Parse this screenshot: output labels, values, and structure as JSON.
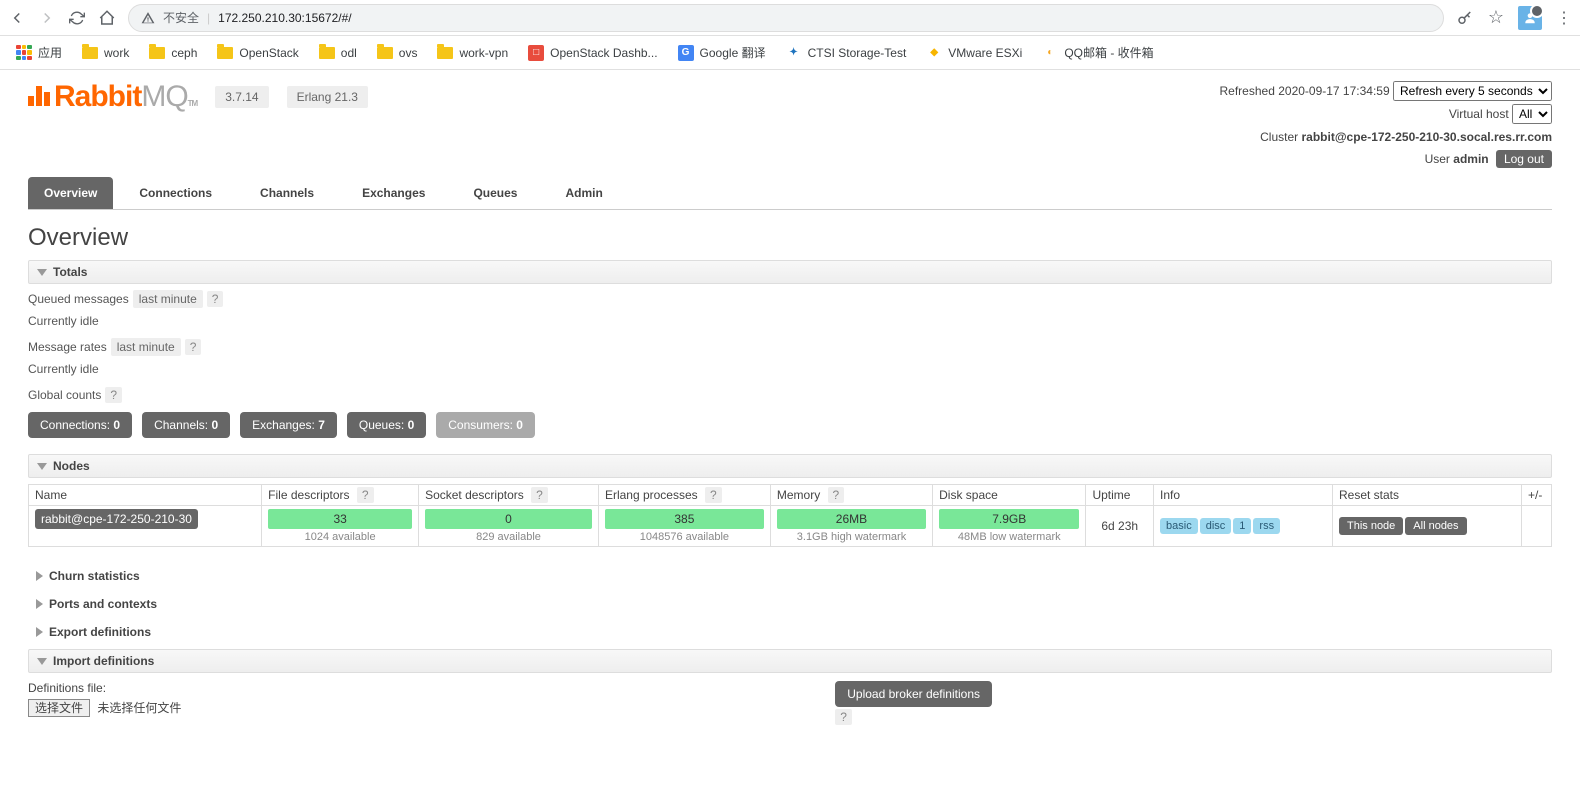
{
  "browser": {
    "insecure": "不安全",
    "url": "172.250.210.30:15672/#/",
    "apps": "应用",
    "bookmarks": [
      {
        "label": "work",
        "type": "folder"
      },
      {
        "label": "ceph",
        "type": "folder"
      },
      {
        "label": "OpenStack",
        "type": "folder"
      },
      {
        "label": "odl",
        "type": "folder"
      },
      {
        "label": "ovs",
        "type": "folder"
      },
      {
        "label": "work-vpn",
        "type": "folder"
      },
      {
        "label": "OpenStack Dashb...",
        "type": "icon",
        "bg": "#e84c3d",
        "fg": "#fff",
        "ch": "□"
      },
      {
        "label": "Google 翻译",
        "type": "icon",
        "bg": "#4285f4",
        "fg": "#fff",
        "ch": "G"
      },
      {
        "label": "CTSI Storage-Test",
        "type": "icon",
        "bg": "#fff",
        "fg": "#1e73be",
        "ch": "✦"
      },
      {
        "label": "VMware ESXi",
        "type": "icon",
        "bg": "#fff",
        "fg": "#f7b500",
        "ch": "◆"
      },
      {
        "label": "QQ邮箱 - 收件箱",
        "type": "icon",
        "bg": "#fff",
        "fg": "#f5a623",
        "ch": "◐"
      }
    ]
  },
  "header": {
    "version": "3.7.14",
    "erlang": "Erlang 21.3",
    "refreshed_lbl": "Refreshed",
    "refreshed_time": "2020-09-17 17:34:59",
    "refresh_options": [
      "Refresh every 5 seconds"
    ],
    "vhost_lbl": "Virtual host",
    "vhost_options": [
      "All"
    ],
    "cluster_lbl": "Cluster",
    "cluster_name": "rabbit@cpe-172-250-210-30.socal.res.rr.com",
    "user_lbl": "User",
    "user_name": "admin",
    "logout": "Log out"
  },
  "tabs": [
    "Overview",
    "Connections",
    "Channels",
    "Exchanges",
    "Queues",
    "Admin"
  ],
  "page_title": "Overview",
  "sections": {
    "totals": "Totals",
    "nodes": "Nodes",
    "churn": "Churn statistics",
    "ports": "Ports and contexts",
    "export": "Export definitions",
    "import": "Import definitions"
  },
  "totals": {
    "queued_lbl": "Queued messages",
    "queued_range": "last minute",
    "idle1": "Currently idle",
    "rates_lbl": "Message rates",
    "rates_range": "last minute",
    "idle2": "Currently idle",
    "global_lbl": "Global counts"
  },
  "counts": [
    {
      "label": "Connections:",
      "value": "0",
      "grey": false
    },
    {
      "label": "Channels:",
      "value": "0",
      "grey": false
    },
    {
      "label": "Exchanges:",
      "value": "7",
      "grey": false
    },
    {
      "label": "Queues:",
      "value": "0",
      "grey": false
    },
    {
      "label": "Consumers:",
      "value": "0",
      "grey": true
    }
  ],
  "nodes_table": {
    "headers": [
      "Name",
      "File descriptors",
      "Socket descriptors",
      "Erlang processes",
      "Memory",
      "Disk space",
      "Uptime",
      "Info",
      "Reset stats",
      "+/-"
    ],
    "row": {
      "name": "rabbit@cpe-172-250-210-30",
      "fd": "33",
      "fd_sub": "1024 available",
      "sd": "0",
      "sd_sub": "829 available",
      "ep": "385",
      "ep_sub": "1048576 available",
      "mem": "26MB",
      "mem_sub": "3.1GB high watermark",
      "disk": "7.9GB",
      "disk_sub": "48MB low watermark",
      "uptime": "6d 23h",
      "info": [
        "basic",
        "disc",
        "1",
        "rss"
      ],
      "reset": [
        "This node",
        "All nodes"
      ]
    }
  },
  "import": {
    "def_lbl": "Definitions file:",
    "choose": "选择文件",
    "nofile": "未选择任何文件",
    "upload": "Upload broker definitions"
  }
}
